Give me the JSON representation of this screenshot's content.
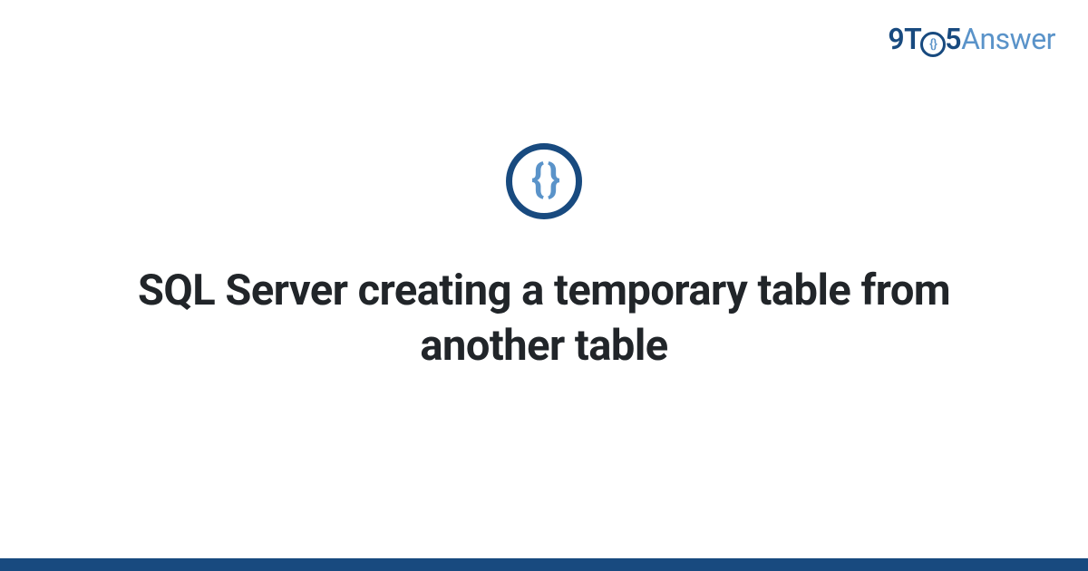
{
  "logo": {
    "part1": "9T",
    "inner_braces": "{}",
    "part2": "5",
    "part3": "Answer"
  },
  "icon": {
    "braces": "{ }"
  },
  "main": {
    "title": "SQL Server creating a temporary table from another table"
  }
}
